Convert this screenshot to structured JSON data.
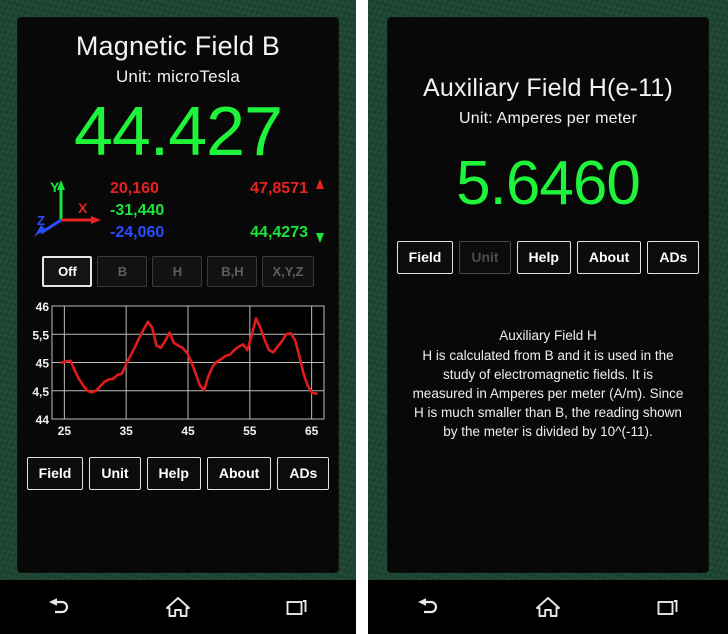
{
  "theme": {
    "frame_color": "#1d4532",
    "screen_color": "#080808",
    "value_green": "#1ef53a",
    "axis_x_red": "#e8221f",
    "axis_y_green": "#19e63c",
    "axis_z_blue": "#2b4cff",
    "chart_line": "#e01b1b"
  },
  "left_panel": {
    "title": "Magnetic Field B",
    "unit_line": "Unit: microTesla",
    "value": "44.427",
    "axis_labels": {
      "x": "X",
      "y": "Y",
      "z": "Z"
    },
    "components": [
      {
        "axis": "x",
        "value": "20,160"
      },
      {
        "axis": "y",
        "value": "-31,440"
      },
      {
        "axis": "z",
        "value": "-24,060"
      }
    ],
    "minmax": {
      "max": "47,8571",
      "min": "44,4273"
    },
    "mode_buttons": [
      {
        "label": "Off",
        "selected": false
      },
      {
        "label": "B",
        "selected": true
      },
      {
        "label": "H",
        "selected": false
      },
      {
        "label": "B,H",
        "selected": false
      },
      {
        "label": "X,Y,Z",
        "selected": false
      }
    ],
    "menu_buttons": [
      {
        "label": "Field",
        "disabled": false
      },
      {
        "label": "Unit",
        "disabled": false
      },
      {
        "label": "Help",
        "disabled": false
      },
      {
        "label": "About",
        "disabled": false
      },
      {
        "label": "ADs",
        "disabled": false
      }
    ]
  },
  "right_panel": {
    "title": "Auxiliary Field H(e-11)",
    "unit_line": "Unit: Amperes per meter",
    "value": "5.6460",
    "menu_buttons": [
      {
        "label": "Field",
        "disabled": false
      },
      {
        "label": "Unit",
        "disabled": true
      },
      {
        "label": "Help",
        "disabled": false
      },
      {
        "label": "About",
        "disabled": false
      },
      {
        "label": "ADs",
        "disabled": false
      }
    ],
    "help": {
      "heading": "Auxiliary Field H",
      "body": "H is calculated from B and it is used in the study of electromagnetic fields. It is measured in Amperes per meter (A/m). Since H is much smaller than B, the reading shown by the meter is divided by 10^(-11)."
    }
  },
  "navbar": {
    "buttons": [
      {
        "name": "back-button",
        "icon": "back-icon"
      },
      {
        "name": "home-button",
        "icon": "home-icon"
      },
      {
        "name": "recents-button",
        "icon": "recents-icon"
      }
    ]
  },
  "chart_data": {
    "type": "line",
    "title": "",
    "xlabel": "",
    "ylabel": "",
    "xlim": [
      23,
      67
    ],
    "ylim": [
      44,
      46
    ],
    "grid": true,
    "legend": false,
    "xticks": [
      25,
      35,
      45,
      55,
      65
    ],
    "xticklabels": [
      "25",
      "35",
      "45",
      "55",
      "65"
    ],
    "yticks": [
      44,
      44.5,
      45,
      45.5,
      46
    ],
    "yticklabels": [
      "44",
      "4,5",
      "45",
      "5,5",
      "46"
    ],
    "series": [
      {
        "name": "B",
        "color": "#e01b1b",
        "x": [
          24.6,
          25.3,
          26.0,
          26.6,
          27.3,
          28.0,
          28.7,
          29.4,
          30.1,
          30.8,
          31.5,
          32.2,
          32.9,
          33.6,
          34.3,
          35.0,
          35.7,
          36.4,
          37.1,
          37.8,
          38.5,
          39.2,
          39.9,
          40.6,
          41.3,
          42.0,
          42.7,
          43.4,
          44.1,
          44.8,
          45.5,
          46.2,
          46.9,
          47.6,
          48.3,
          49.0,
          49.7,
          50.4,
          51.1,
          51.8,
          52.5,
          53.2,
          53.9,
          54.6,
          55.3,
          56.0,
          56.7,
          57.4,
          58.1,
          58.8,
          59.5,
          60.2,
          60.9,
          61.6,
          62.3,
          63.0,
          63.7,
          64.4,
          65.1,
          65.8
        ],
        "y": [
          45.0,
          45.02,
          45.03,
          44.88,
          44.72,
          44.6,
          44.5,
          44.47,
          44.5,
          44.58,
          44.66,
          44.7,
          44.71,
          44.78,
          44.8,
          44.97,
          45.12,
          45.27,
          45.43,
          45.58,
          45.72,
          45.62,
          45.3,
          45.26,
          45.38,
          45.53,
          45.35,
          45.3,
          45.26,
          45.18,
          45.02,
          44.82,
          44.6,
          44.51,
          44.76,
          44.93,
          45.02,
          45.06,
          45.12,
          45.14,
          45.22,
          45.28,
          45.32,
          45.22,
          45.48,
          45.78,
          45.62,
          45.4,
          45.22,
          45.18,
          45.28,
          45.38,
          45.5,
          45.52,
          45.4,
          45.12,
          44.8,
          44.58,
          44.46,
          44.45
        ]
      }
    ]
  }
}
